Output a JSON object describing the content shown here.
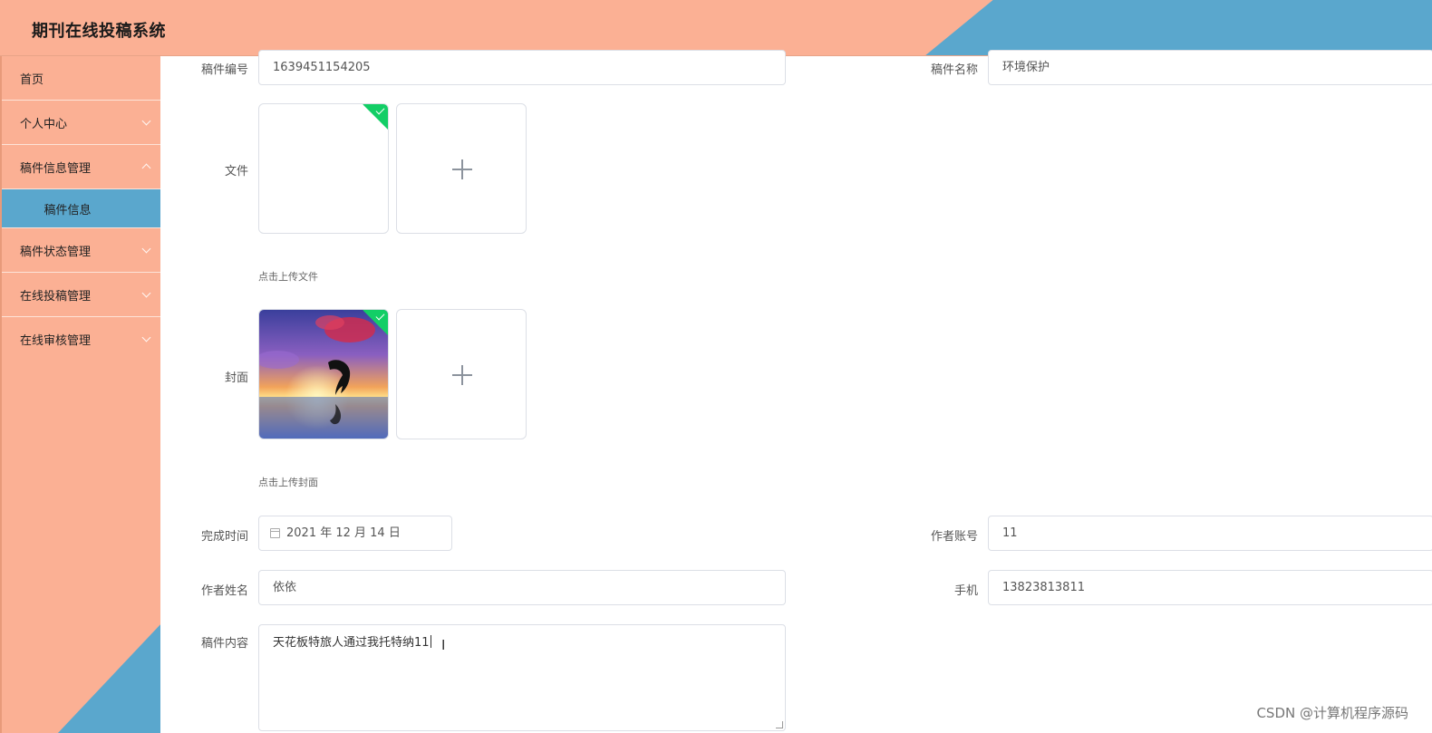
{
  "header": {
    "title": "期刊在线投稿系统"
  },
  "sidebar": {
    "items": [
      {
        "label": "首页"
      },
      {
        "label": "个人中心"
      },
      {
        "label": "稿件信息管理"
      },
      {
        "label": "稿件信息"
      },
      {
        "label": "稿件状态管理"
      },
      {
        "label": "在线投稿管理"
      },
      {
        "label": "在线审核管理"
      }
    ]
  },
  "form": {
    "manuscript_no": {
      "label": "稿件编号",
      "value": "1639451154205"
    },
    "manuscript_name": {
      "label": "稿件名称",
      "value": "环境保护"
    },
    "file": {
      "label": "文件",
      "tip": "点击上传文件"
    },
    "cover": {
      "label": "封面",
      "tip": "点击上传封面"
    },
    "finish_time": {
      "label": "完成时间",
      "value": "2021 年 12 月 14 日"
    },
    "author_account": {
      "label": "作者账号",
      "value": "11"
    },
    "author_name": {
      "label": "作者姓名",
      "value": "依依"
    },
    "phone": {
      "label": "手机",
      "value": "13823813811"
    },
    "content": {
      "label": "稿件内容",
      "value": "天花板特旅人通过我托特纳11"
    }
  },
  "watermark": "CSDN @计算机程序源码",
  "colors": {
    "header_bg": "#fbb094",
    "accent_blue": "#5aa7cd",
    "success": "#13ce66"
  }
}
